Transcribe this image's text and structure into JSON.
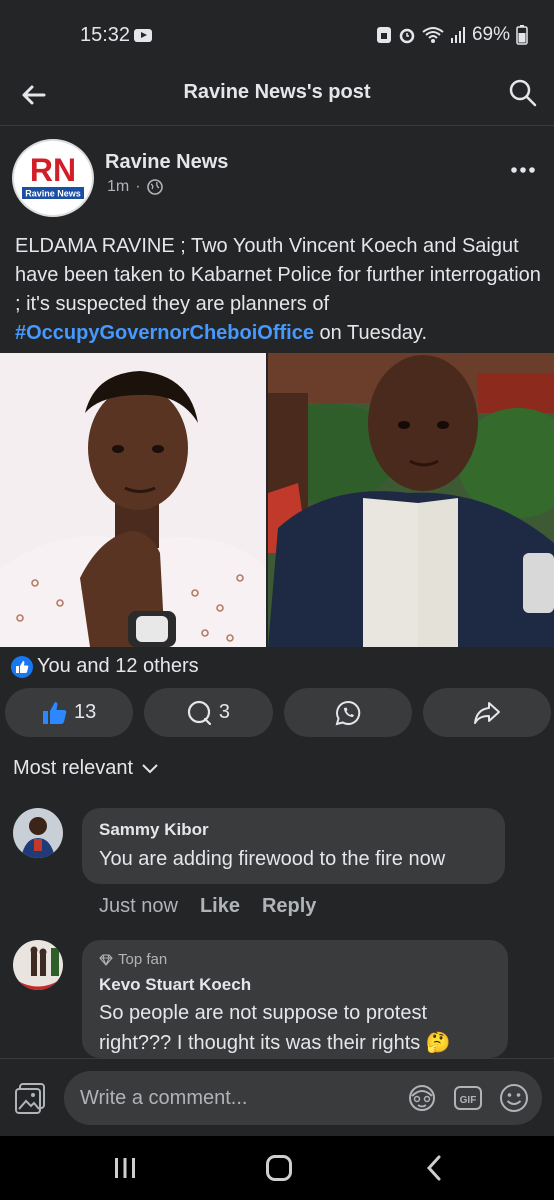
{
  "status": {
    "time": "15:32",
    "battery": "69%"
  },
  "header": {
    "title": "Ravine News's post"
  },
  "post": {
    "page_name": "Ravine News",
    "avatar_letters": "RN",
    "avatar_caption": "Ravine News",
    "time": "1m",
    "time_sep": "·",
    "text_main": "ELDAMA RAVINE ; Two Youth Vincent Koech and Saigut have been taken to Kabarnet Police for further interrogation ; it's suspected they are planners of ",
    "hashtag": "#OccupyGovernorCheboiOffice",
    "text_tail": " on Tuesday.",
    "reactions_text": "You and 12 others",
    "like_count": "13",
    "comment_count": "3"
  },
  "comments_section": {
    "sort_label": "Most relevant"
  },
  "comments": [
    {
      "name": "Sammy Kibor",
      "text": "You are adding firewood to the fire now",
      "time": "Just now",
      "like_label": "Like",
      "reply_label": "Reply"
    },
    {
      "badge": "Top fan",
      "name": "Kevo Stuart Koech",
      "text": "So people are not suppose to protest right??? I thought its was their rights",
      "emoji": "🤔"
    }
  ],
  "composer": {
    "placeholder": "Write a comment...",
    "gif_label": "GIF"
  },
  "colors": {
    "background": "#242526",
    "surface": "#3a3b3c",
    "accent": "#1877f2",
    "hashtag": "#4599ff",
    "text": "#e4e6eb",
    "muted": "#b0b3b8"
  }
}
